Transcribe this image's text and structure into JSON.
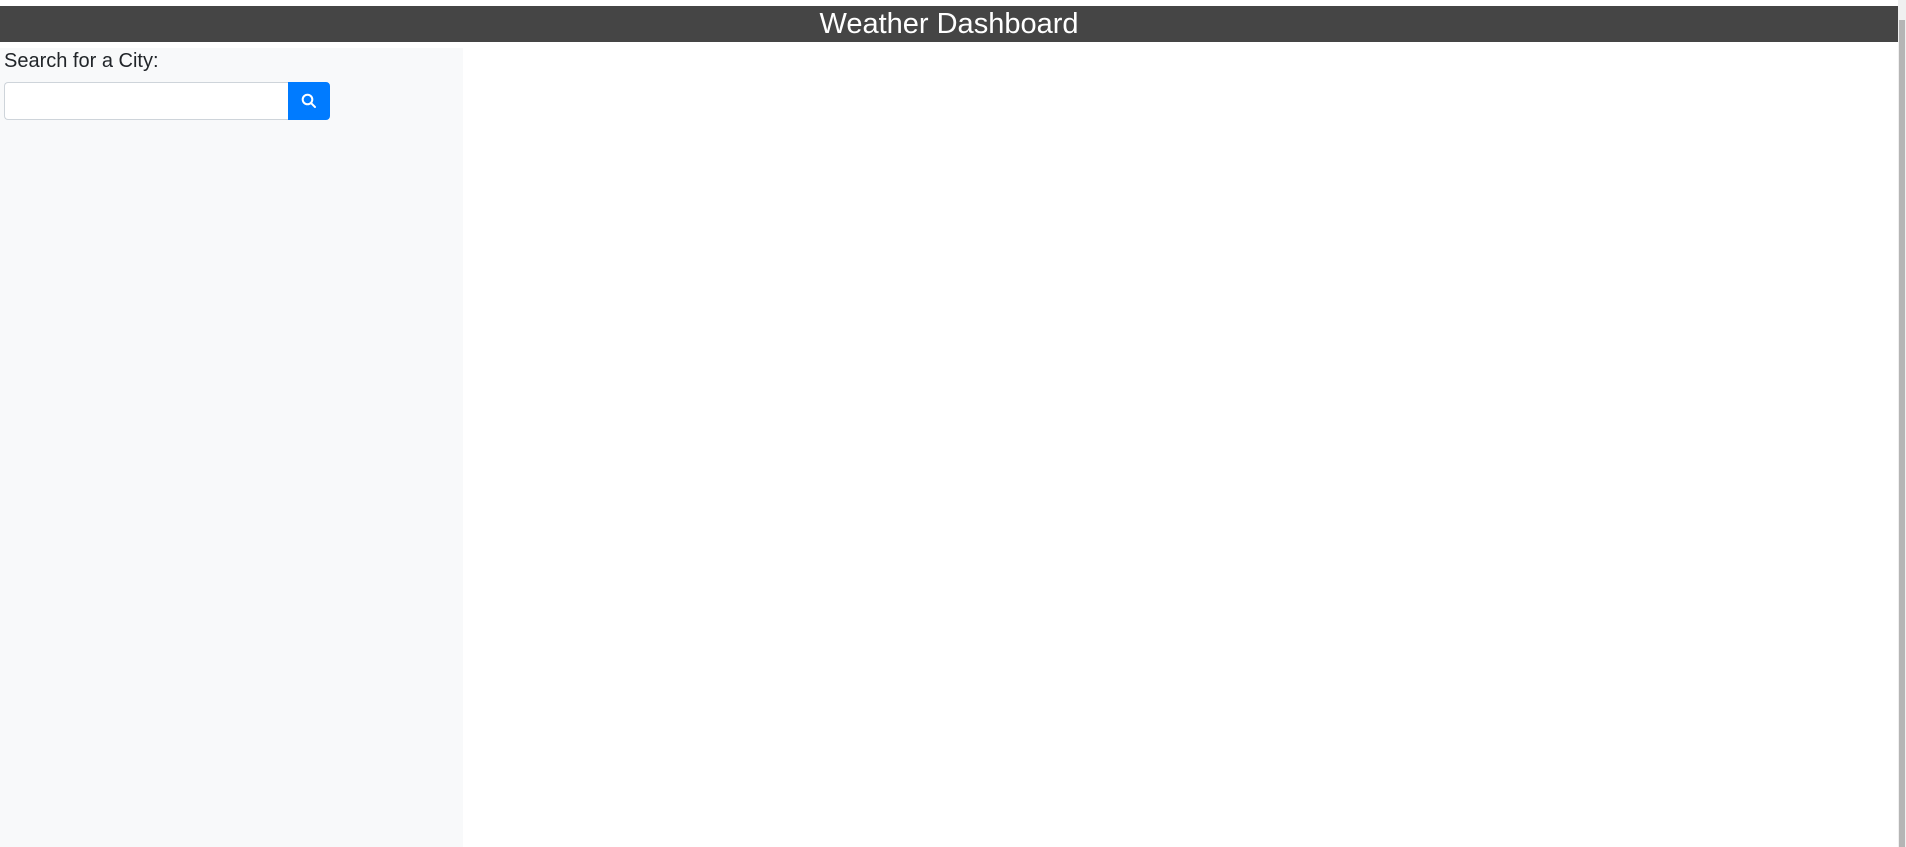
{
  "header": {
    "title": "Weather Dashboard"
  },
  "sidebar": {
    "search_label": "Search for a City:",
    "search_input": {
      "value": "",
      "placeholder": ""
    },
    "search_button_icon": "search-icon"
  },
  "colors": {
    "header_bg": "#454545",
    "sidebar_bg": "#f8f9fa",
    "accent": "#007bff"
  }
}
